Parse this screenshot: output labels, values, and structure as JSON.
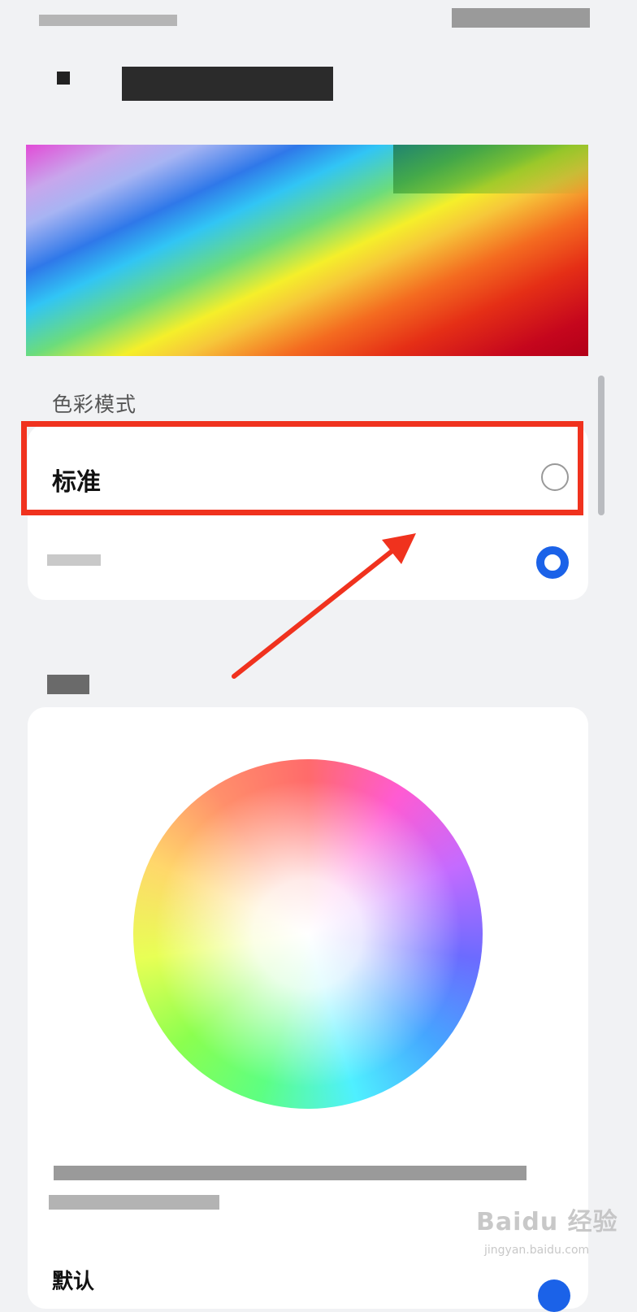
{
  "section": {
    "color_mode_label": "色彩模式"
  },
  "options": [
    {
      "label": "标准",
      "selected": false
    },
    {
      "label": "",
      "selected": true
    }
  ],
  "bottom_item": {
    "label": "默认"
  },
  "watermark": {
    "text": "Baidu 经验",
    "subtext": "jingyan.baidu.com"
  },
  "colors": {
    "background": "#f1f2f4",
    "card": "#ffffff",
    "accent": "#1b62e8",
    "annotation": "#f0321e"
  },
  "icons": [
    "radio-unselected-icon",
    "radio-selected-icon",
    "annotation-arrow-icon"
  ]
}
